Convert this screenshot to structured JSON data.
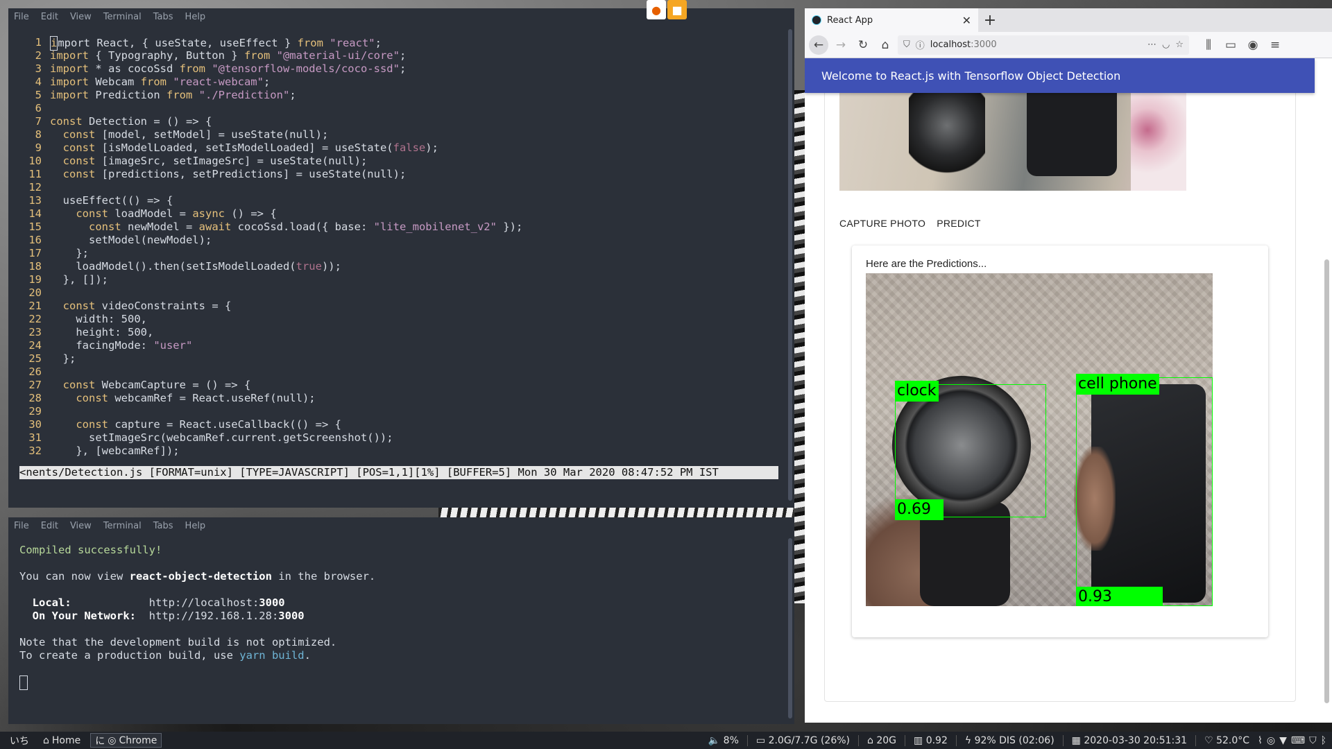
{
  "terminal_menu": [
    "File",
    "Edit",
    "View",
    "Terminal",
    "Tabs",
    "Help"
  ],
  "editor": {
    "lines": [
      {
        "n": "1",
        "html": "<span class=\"cursor-box\"></span><span class=\"kw\">mport</span> React, { useState, useEffect } <span class=\"kw\">from</span> <span class=\"str\">\"react\"</span>;",
        "text": "import React, { useState, useEffect } from \"react\";"
      },
      {
        "n": "2",
        "text": "import { Typography, Button } from \"@material-ui/core\";"
      },
      {
        "n": "3",
        "text": "import * as cocoSsd from \"@tensorflow-models/coco-ssd\";"
      },
      {
        "n": "4",
        "text": "import Webcam from \"react-webcam\";"
      },
      {
        "n": "5",
        "text": "import Prediction from \"./Prediction\";"
      },
      {
        "n": "6",
        "text": ""
      },
      {
        "n": "7",
        "text": "const Detection = () => {"
      },
      {
        "n": "8",
        "text": "  const [model, setModel] = useState(null);"
      },
      {
        "n": "9",
        "text": "  const [isModelLoaded, setIsModelLoaded] = useState(false);"
      },
      {
        "n": "10",
        "text": "  const [imageSrc, setImageSrc] = useState(null);"
      },
      {
        "n": "11",
        "text": "  const [predictions, setPredictions] = useState(null);"
      },
      {
        "n": "12",
        "text": ""
      },
      {
        "n": "13",
        "text": "  useEffect(() => {"
      },
      {
        "n": "14",
        "text": "    const loadModel = async () => {"
      },
      {
        "n": "15",
        "text": "      const newModel = await cocoSsd.load({ base: \"lite_mobilenet_v2\" });"
      },
      {
        "n": "16",
        "text": "      setModel(newModel);"
      },
      {
        "n": "17",
        "text": "    };"
      },
      {
        "n": "18",
        "text": "    loadModel().then(setIsModelLoaded(true));"
      },
      {
        "n": "19",
        "text": "  }, []);"
      },
      {
        "n": "20",
        "text": ""
      },
      {
        "n": "21",
        "text": "  const videoConstraints = {"
      },
      {
        "n": "22",
        "text": "    width: 500,"
      },
      {
        "n": "23",
        "text": "    height: 500,"
      },
      {
        "n": "24",
        "text": "    facingMode: \"user\""
      },
      {
        "n": "25",
        "text": "  };"
      },
      {
        "n": "26",
        "text": ""
      },
      {
        "n": "27",
        "text": "  const WebcamCapture = () => {"
      },
      {
        "n": "28",
        "text": "    const webcamRef = React.useRef(null);"
      },
      {
        "n": "29",
        "text": ""
      },
      {
        "n": "30",
        "text": "    const capture = React.useCallback(() => {"
      },
      {
        "n": "31",
        "text": "      setImageSrc(webcamRef.current.getScreenshot());"
      },
      {
        "n": "32",
        "text": "    }, [webcamRef]);"
      }
    ],
    "statusline": "<nents/Detection.js [FORMAT=unix] [TYPE=JAVASCRIPT] [POS=1,1][1%] [BUFFER=5] Mon 30 Mar 2020 08:47:52 PM IST"
  },
  "console": {
    "compiled": "Compiled successfully!",
    "view_prefix": "You can now view ",
    "app_name": "react-object-detection",
    "view_suffix": " in the browser.",
    "local_label": "Local:",
    "local_url_prefix": "http://localhost:",
    "local_port": "3000",
    "network_label": "On Your Network:",
    "network_url_prefix": "http://192.168.1.28:",
    "network_port": "3000",
    "note": "Note that the development build is not optimized.",
    "prod_prefix": "To create a production build, use ",
    "prod_cmd": "yarn build",
    "prod_suffix": "."
  },
  "browser": {
    "tab_title": "React App",
    "url_host": "localhost",
    "url_port": ":3000",
    "appbar_title": "Welcome to React.js with Tensorflow Object Detection",
    "capture_label": "CAPTURE PHOTO",
    "predict_label": "PREDICT",
    "predictions_heading": "Here are the Predictions...",
    "detections": [
      {
        "label": "clock",
        "score": "0.69"
      },
      {
        "label": "cell phone",
        "score": "0.93"
      }
    ]
  },
  "taskbar": {
    "workspace": "いち",
    "home_label": "Home",
    "kanji": "に",
    "chrome_label": "Chrome",
    "volume": "8%",
    "memory": "2.0G/7.7G (26%)",
    "disk": "20G",
    "load": "0.92",
    "battery": "92% DIS (02:06)",
    "datetime": "2020-03-30 20:51:31",
    "temperature": "52.0°C"
  },
  "colors": {
    "appbar": "#3f51b5",
    "detection_box": "#00ff00",
    "terminal_bg": "#2b3039"
  }
}
